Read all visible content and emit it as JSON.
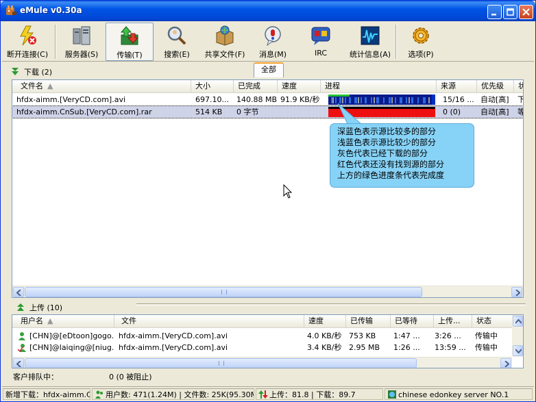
{
  "window": {
    "title": "eMule v0.30a"
  },
  "toolbar": {
    "buttons": [
      {
        "label": "断开连接(C)"
      },
      {
        "label": "服务器(S)"
      },
      {
        "label": "传输(T)"
      },
      {
        "label": "搜索(E)"
      },
      {
        "label": "共享文件(F)"
      },
      {
        "label": "消息(M)"
      },
      {
        "label": "IRC"
      },
      {
        "label": "统计信息(A)"
      },
      {
        "label": "选项(P)"
      }
    ]
  },
  "downloads": {
    "header": "下载 (2)",
    "tab_all": "全部",
    "columns": [
      "文件名",
      "大小",
      "已完成",
      "速度",
      "进程",
      "来源",
      "优先级",
      "状"
    ],
    "rows": [
      {
        "name": "hfdx-aimm.[VeryCD.com].avi",
        "size": "697.10...",
        "done": "140.88 MB",
        "speed": "91.9 KB/秒",
        "sources": "15/16 ...",
        "priority": "自动[高]",
        "status": "下",
        "progress": 0.2
      },
      {
        "name": "hfdx-aimm.CnSub.[VeryCD.com].rar",
        "size": "514 KB",
        "done": "0 字节",
        "speed": "",
        "sources": "0 (0)",
        "priority": "自动[高]",
        "status": "等",
        "progress": 0.0
      }
    ]
  },
  "tooltip": {
    "lines": [
      "深蓝色表示源比较多的部分",
      "浅蓝色表示源比较少的部分",
      "灰色代表已经下载的部分",
      "红色代表还没有找到源的部分",
      "上方的绿色进度条代表完成度"
    ]
  },
  "uploads": {
    "header": "上传 (10)",
    "columns": [
      "用户名",
      "文件",
      "速度",
      "已传输",
      "已等待",
      "上传...",
      "状态"
    ],
    "rows": [
      {
        "user": "[CHN]@[eDtoon]gogo...",
        "file": "hfdx-aimm.[VeryCD.com].avi",
        "speed": "4.0 KB/秒",
        "transferred": "753 KB",
        "waited": "1:47 ...",
        "upload_time": "3:26 ...",
        "status": "传输中"
      },
      {
        "user": "[CHN]@laiqing@[niug...",
        "file": "hfdx-aimm.[VeryCD.com].avi",
        "speed": "3.4 KB/秒",
        "transferred": "2.95 MB",
        "waited": "1:26 ...",
        "upload_time": "13:59 ...",
        "status": "传输中"
      }
    ]
  },
  "queue": {
    "label": "客户排队中：",
    "value": "0 (0 被阻止)"
  },
  "statusbar": {
    "new_download": "新增下载：hfdx-aimm.C",
    "users": "用户数: 471(1.24M) | 文件数: 25K(95.30M)",
    "transfer": "上传：81.8 | 下载：89.7",
    "server": "chinese edonkey server NO.1"
  }
}
